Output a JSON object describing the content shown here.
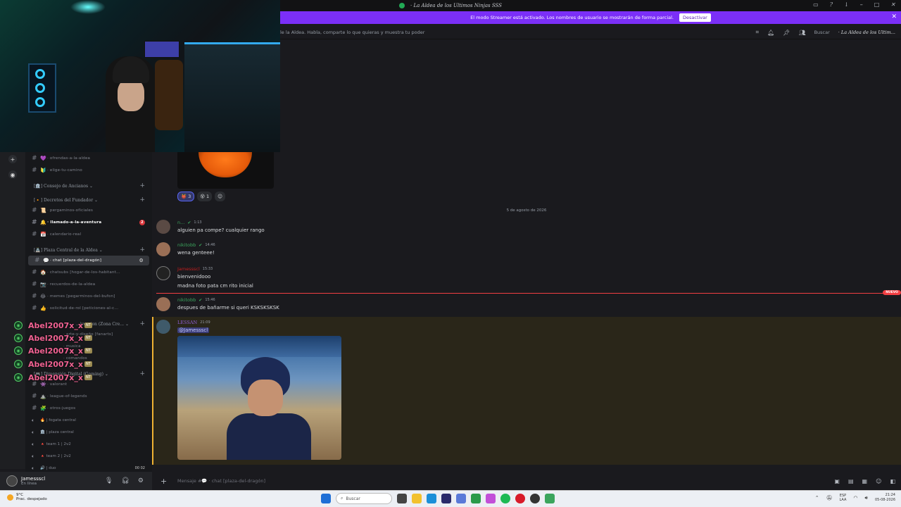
{
  "window": {
    "title": "· La Aldea de los Ultimos Ninjas SSS",
    "controls": [
      "inbox-icon",
      "help-icon",
      "download-icon",
      "minimize-icon",
      "maximize-icon",
      "close-icon"
    ]
  },
  "streamer_banner": {
    "text": "El modo Streamer está activado. Los nombres de usuario se mostrarán de forma parcial.",
    "button": "Desactivar",
    "color": "#7b2ff7"
  },
  "channel_header": {
    "topic": "le la Aldea. Habla, comparte lo que quieras y muestra tu poder",
    "search": "Buscar",
    "server": "· La Aldea de los Ultim..."
  },
  "sidebar": {
    "channels_top": [
      {
        "emoji": "💜",
        "name": "· ofrendas-a-la-aldea"
      },
      {
        "emoji": "🔰",
        "name": "· elige-tu-camino"
      }
    ],
    "cat_consejo": "[🏛️] Consejo de Ancianos ⌄",
    "cat_decretos": "[🔸] Decretos del Fundador ⌄",
    "decretos": [
      {
        "emoji": "📜",
        "name": "· pergaminos-oficiales"
      },
      {
        "emoji": "🔔",
        "name": "· llamado-a-la-aventura",
        "badge": "2"
      },
      {
        "emoji": "📅",
        "name": "· calendario-real"
      }
    ],
    "cat_plaza": "[🏯] Plaza Central de la Aldea ⌄",
    "plaza": [
      {
        "emoji": "💬",
        "name": "· chat [plaza-del-dragón]"
      },
      {
        "emoji": "🏠",
        "name": "· chatsubs [hogar-de-los-habitant..."
      },
      {
        "emoji": "📷",
        "name": "· recuerdos-de-la-aldea"
      },
      {
        "emoji": "😂",
        "name": "· memes [pegarminos-del-bufon]"
      },
      {
        "emoji": "👍",
        "name": "· solicitud-de-rol [peticiones-al-c..."
      }
    ],
    "cat_diversion": "...iversion (Zona Cre... ⌄",
    "diversion": [
      {
        "name": "· arte-y-diseño [fanarts]"
      },
      {
        "name": "· musica"
      },
      {
        "name": "· comandos"
      }
    ],
    "cat_gaming": "[🎮] Dimensión Digital (Gaming) ⌄",
    "gaming": [
      {
        "emoji": "👾",
        "name": "· valorant"
      },
      {
        "emoji": "⛰️",
        "name": "· league-of-legends"
      },
      {
        "emoji": "🧩",
        "name": "· otros-juegos"
      }
    ],
    "voice": [
      {
        "name": "🔥 | fogata central"
      },
      {
        "name": "🏛️ | plaza central"
      },
      {
        "name": "🔺 team 1 | 2v2"
      },
      {
        "name": "🔺 team 2 | 2v2"
      },
      {
        "name": "🔊 | duo",
        "counts": "00 02"
      }
    ]
  },
  "overlay_users": [
    {
      "name": "Abel2007x_x",
      "tag": "NT"
    },
    {
      "name": "Abel2007x_x",
      "tag": "NT"
    },
    {
      "name": "Abel2007x_x",
      "tag": "NT"
    },
    {
      "name": "Abel2007x_x",
      "tag": "NT"
    },
    {
      "name": "Abel2007x_x",
      "tag": "NT"
    }
  ],
  "user": {
    "name": "Jamessscl",
    "status": "En línea"
  },
  "reactions": [
    {
      "emoji": "👹",
      "count": "3"
    },
    {
      "emoji": "😵",
      "count": "1"
    }
  ],
  "date_divider": "5 de agosto de 2026",
  "messages": [
    {
      "author": "n...",
      "color": "#3ba55d",
      "time": "1:13",
      "text": "alguien pa compe? cualquier rango"
    },
    {
      "author": "nikitobb",
      "color": "#3ba55d",
      "time": "14:46",
      "text": "wena genteee!"
    },
    {
      "author": "Jamessscl",
      "color": "#c41d1d",
      "time": "15:33",
      "text": "bienvenidooo",
      "text2": "madna foto pata cm rito inicial"
    },
    {
      "author": "nikitobb",
      "color": "#3ba55d",
      "time": "15:46",
      "text": "despues de bañarme si queri KSKSKSKSK"
    },
    {
      "author": "LESSAN",
      "color": "#8e5fd6",
      "time": "21:09",
      "mention": "@Jamessscl"
    }
  ],
  "new_tag": "NUEVO",
  "composer": {
    "placeholder": "Mensaje #💬 · chat [plaza-del-dragón]"
  },
  "taskbar": {
    "weather_temp": "9°C",
    "weather_desc": "Prac. despejado",
    "search": "Buscar",
    "lang1": "ESP",
    "lang2": "LAA",
    "time": "21:24",
    "date": "05-08-2026"
  }
}
